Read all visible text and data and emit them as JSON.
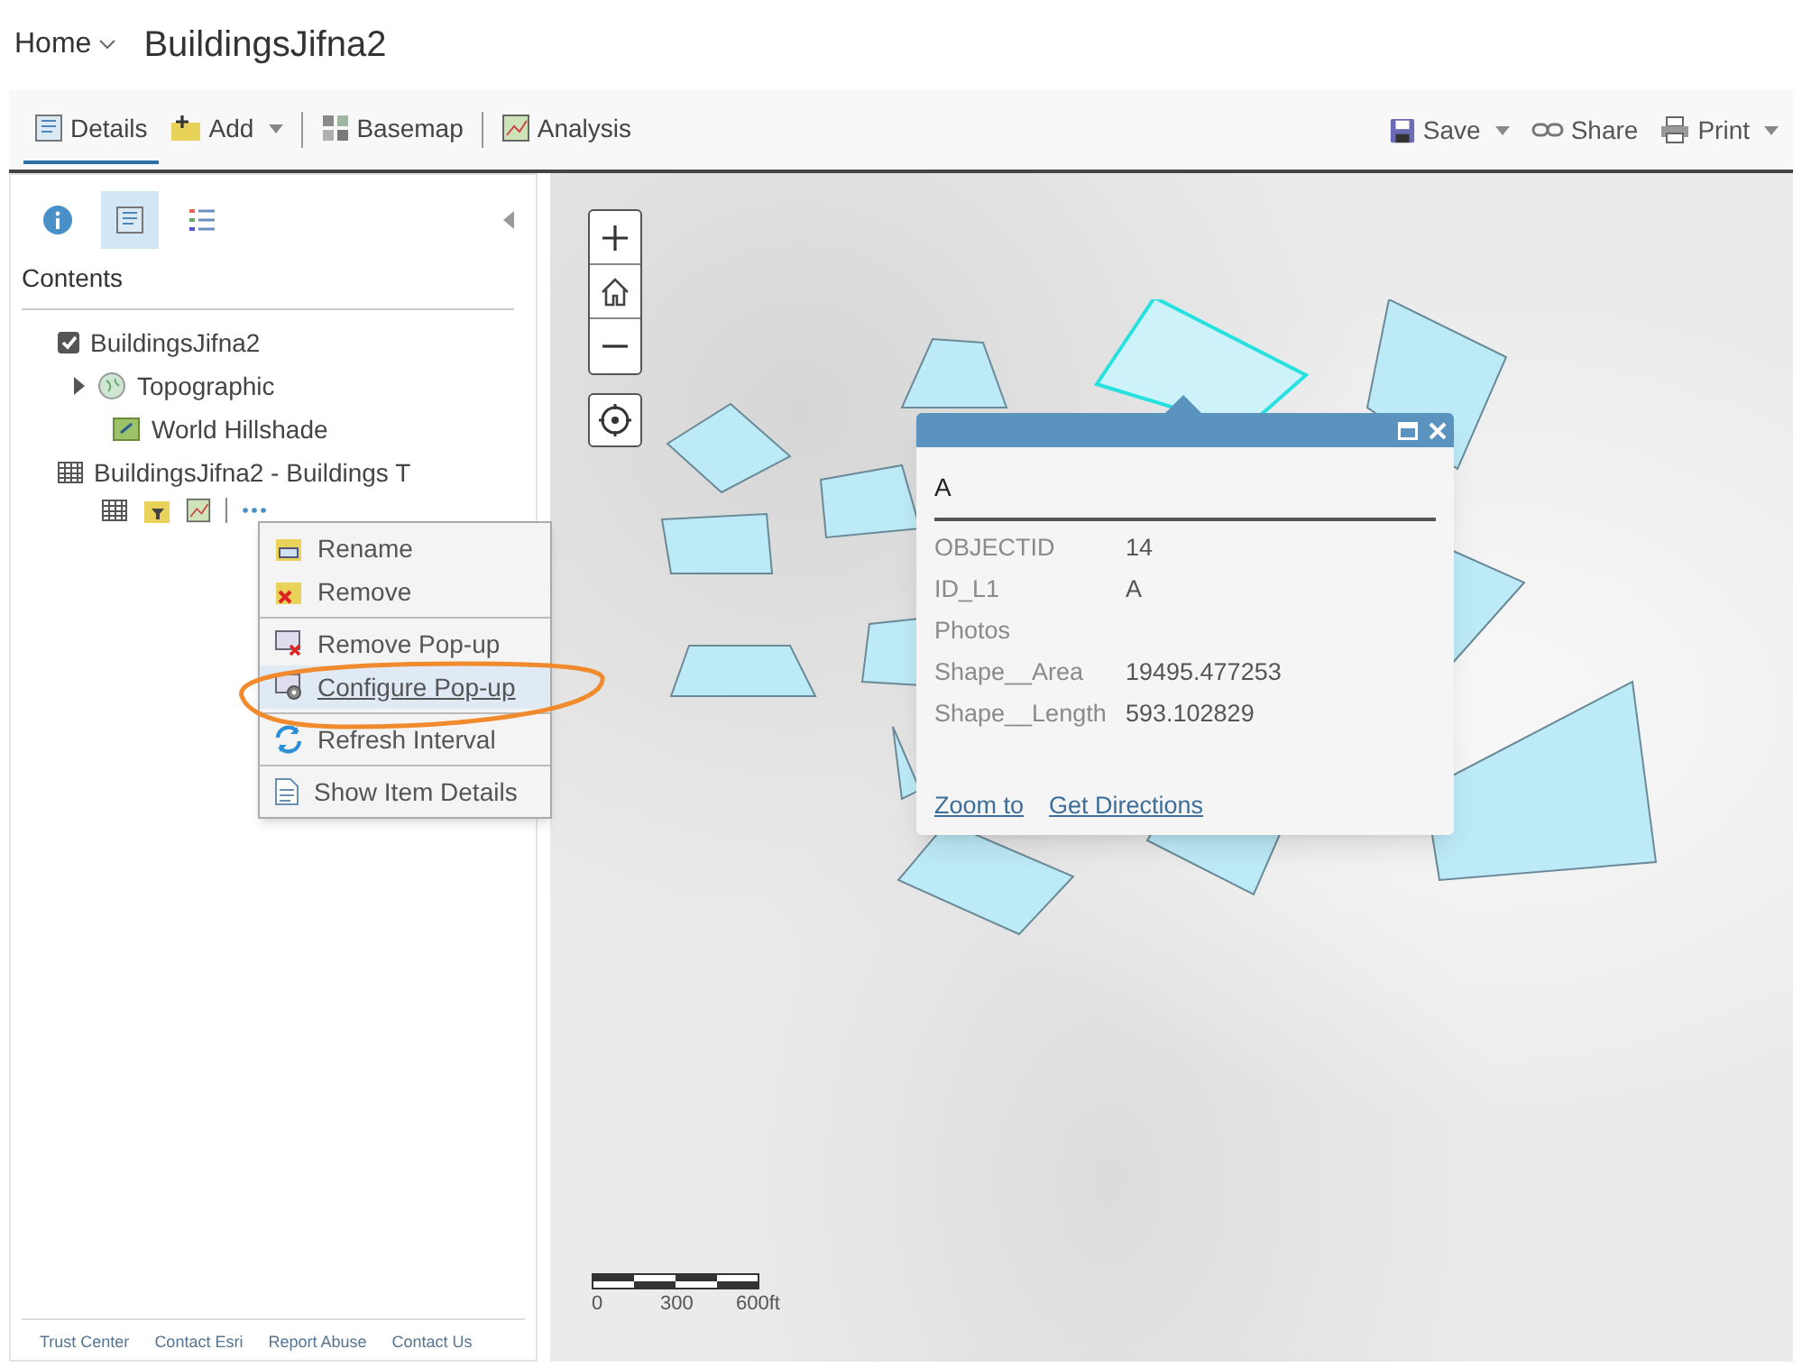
{
  "header": {
    "home_label": "Home",
    "title": "BuildingsJifna2"
  },
  "toolbar": {
    "left": [
      {
        "label": "Details",
        "dropdown": false,
        "selected": true
      },
      {
        "label": "Add",
        "dropdown": true,
        "selected": false
      },
      {
        "label": "Basemap",
        "dropdown": false,
        "selected": false
      },
      {
        "label": "Analysis",
        "dropdown": false,
        "selected": false
      }
    ],
    "right": [
      {
        "label": "Save",
        "dropdown": true
      },
      {
        "label": "Share",
        "dropdown": false
      },
      {
        "label": "Print",
        "dropdown": true
      }
    ]
  },
  "panel": {
    "tabs": [
      {
        "kind": "about",
        "selected": false
      },
      {
        "kind": "content",
        "selected": true
      },
      {
        "kind": "legend",
        "selected": false
      }
    ],
    "heading": "Contents",
    "layers": [
      {
        "name": "BuildingsJifna2",
        "checked": true,
        "children": [
          {
            "name": "Topographic",
            "kind": "basemap",
            "expanded": false
          },
          {
            "name": "World Hillshade",
            "kind": "tile"
          }
        ]
      },
      {
        "name": "BuildingsJifna2 - Buildings T",
        "kind": "table",
        "tools": true
      }
    ],
    "context_menu": [
      [
        {
          "label": "Rename",
          "kind": "rename",
          "selected": false
        },
        {
          "label": "Remove",
          "kind": "remove",
          "selected": false
        }
      ],
      [
        {
          "label": "Remove Pop-up",
          "kind": "remove-popup",
          "selected": false
        },
        {
          "label": "Configure Pop-up",
          "kind": "configure-popup",
          "selected": true
        }
      ],
      [
        {
          "label": "Refresh Interval",
          "kind": "refresh",
          "selected": false
        }
      ],
      [
        {
          "label": "Show Item Details",
          "kind": "details",
          "selected": false
        }
      ]
    ],
    "footer_links": [
      "Trust Center",
      "Contact Esri",
      "Report Abuse",
      "Contact Us"
    ]
  },
  "popup": {
    "title": "A",
    "fields": [
      {
        "label": "OBJECTID",
        "value": "14"
      },
      {
        "label": "ID_L1",
        "value": "A"
      },
      {
        "label": "Photos"
      },
      {
        "label": "Shape__Area",
        "value": "19495.477253"
      },
      {
        "label": "Shape__Length",
        "value": "593.102829"
      }
    ],
    "links": [
      "Zoom to",
      "Get Directions"
    ]
  },
  "scale_bar": {
    "labels": [
      "0",
      "300",
      "600ft"
    ]
  }
}
